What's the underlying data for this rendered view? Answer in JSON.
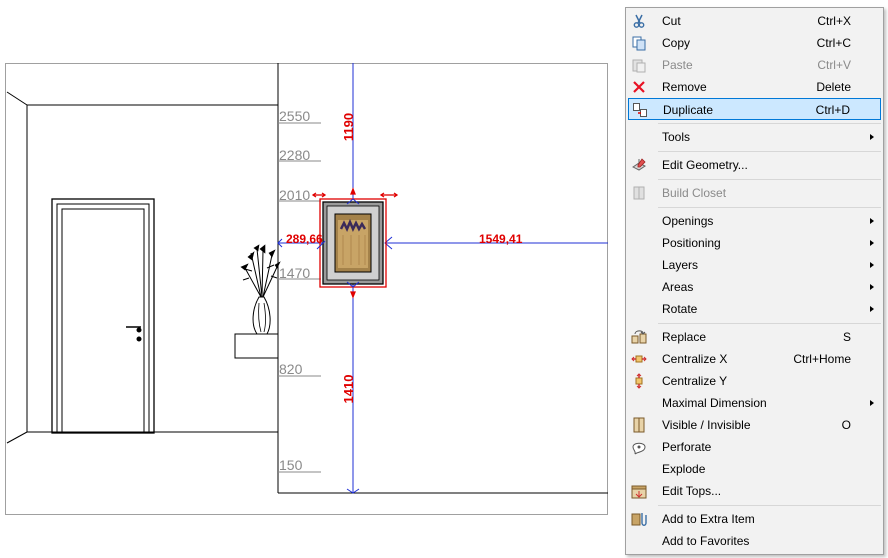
{
  "drawing": {
    "dimensions": {
      "top_vertical": "1190",
      "bottom_vertical": "1410",
      "left_horizontal": "289,66",
      "right_horizontal": "1549,41"
    },
    "ruler_marks": [
      "2550",
      "2280",
      "2010",
      "1470",
      "820",
      "150"
    ]
  },
  "context_menu": {
    "items": [
      {
        "label": "Cut",
        "shortcut": "Ctrl+X",
        "icon": "scissors-icon",
        "disabled": false
      },
      {
        "label": "Copy",
        "shortcut": "Ctrl+C",
        "icon": "copy-icon",
        "disabled": false
      },
      {
        "label": "Paste",
        "shortcut": "Ctrl+V",
        "icon": "paste-icon",
        "disabled": true
      },
      {
        "label": "Remove",
        "shortcut": "Delete",
        "icon": "remove-x-icon",
        "disabled": false
      },
      {
        "label": "Duplicate",
        "shortcut": "Ctrl+D",
        "icon": "duplicate-icon",
        "highlighted": true
      },
      {
        "label": "Tools",
        "submenu": true
      },
      {
        "label": "Edit Geometry...",
        "icon": "edit-geometry-icon"
      },
      {
        "label": "Build Closet",
        "icon": "build-closet-icon",
        "disabled": true
      },
      {
        "label": "Openings",
        "submenu": true
      },
      {
        "label": "Positioning",
        "submenu": true
      },
      {
        "label": "Layers",
        "submenu": true
      },
      {
        "label": "Areas",
        "submenu": true
      },
      {
        "label": "Rotate",
        "submenu": true
      },
      {
        "label": "Replace",
        "shortcut": "S",
        "icon": "replace-icon"
      },
      {
        "label": "Centralize X",
        "shortcut": "Ctrl+Home",
        "icon": "centralize-x-icon"
      },
      {
        "label": "Centralize Y",
        "icon": "centralize-y-icon"
      },
      {
        "label": "Maximal Dimension",
        "submenu": true
      },
      {
        "label": "Visible / Invisible",
        "shortcut": "O",
        "icon": "visibility-icon"
      },
      {
        "label": "Perforate",
        "icon": "perforate-icon"
      },
      {
        "label": "Explode"
      },
      {
        "label": "Edit Tops...",
        "icon": "edit-tops-icon"
      },
      {
        "label": "Add to Extra Item",
        "icon": "extra-item-icon"
      },
      {
        "label": "Add to Favorites"
      }
    ]
  },
  "colors": {
    "dimension_blue": "#1f2fd6",
    "dimension_red": "#e00000",
    "highlight_bg": "#cce8ff",
    "highlight_border": "#0078d7"
  }
}
